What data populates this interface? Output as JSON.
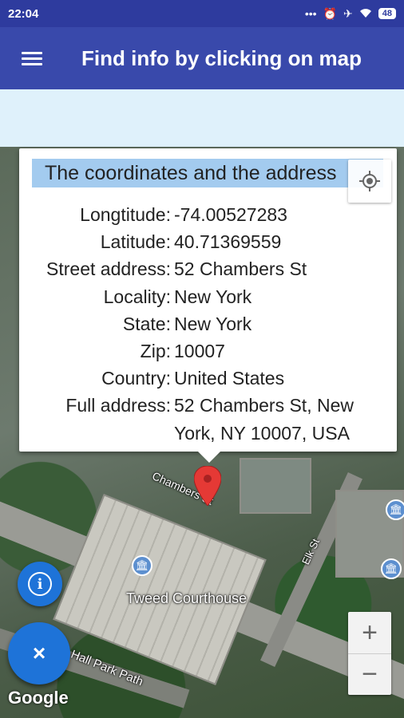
{
  "status_bar": {
    "time": "22:04",
    "icons": [
      "more-icon",
      "alarm-icon",
      "airplane-icon",
      "wifi-icon"
    ],
    "battery": "48"
  },
  "app_bar": {
    "title": "Find info by clicking on map"
  },
  "popup": {
    "title": "The coordinates and the address",
    "rows": [
      {
        "label": "Longtitude:",
        "value": "-74.00527283"
      },
      {
        "label": "Latitude:",
        "value": "40.71369559"
      },
      {
        "label": "Street address:",
        "value": "52 Chambers St"
      },
      {
        "label": "Locality:",
        "value": "New York"
      },
      {
        "label": "State:",
        "value": "New York"
      },
      {
        "label": "Zip:",
        "value": "10007"
      },
      {
        "label": "Country:",
        "value": "United States"
      },
      {
        "label": "Full address:",
        "value": "52 Chambers St, New York, NY 10007, USA"
      }
    ]
  },
  "map": {
    "labels": {
      "chambers": "Chambers St",
      "elk": "Elk St",
      "tweed": "Tweed Courthouse",
      "hall_park": "Hall Park Path",
      "google": "Google"
    },
    "zoom_in": "+",
    "zoom_out": "−"
  },
  "fab": {
    "info": "i",
    "close": "×"
  },
  "colors": {
    "status_bar": "#2e3b9e",
    "app_bar": "#3949ab",
    "fab": "#1e73d8",
    "title_highlight": "#a3cbef",
    "pin": "#e53935"
  }
}
